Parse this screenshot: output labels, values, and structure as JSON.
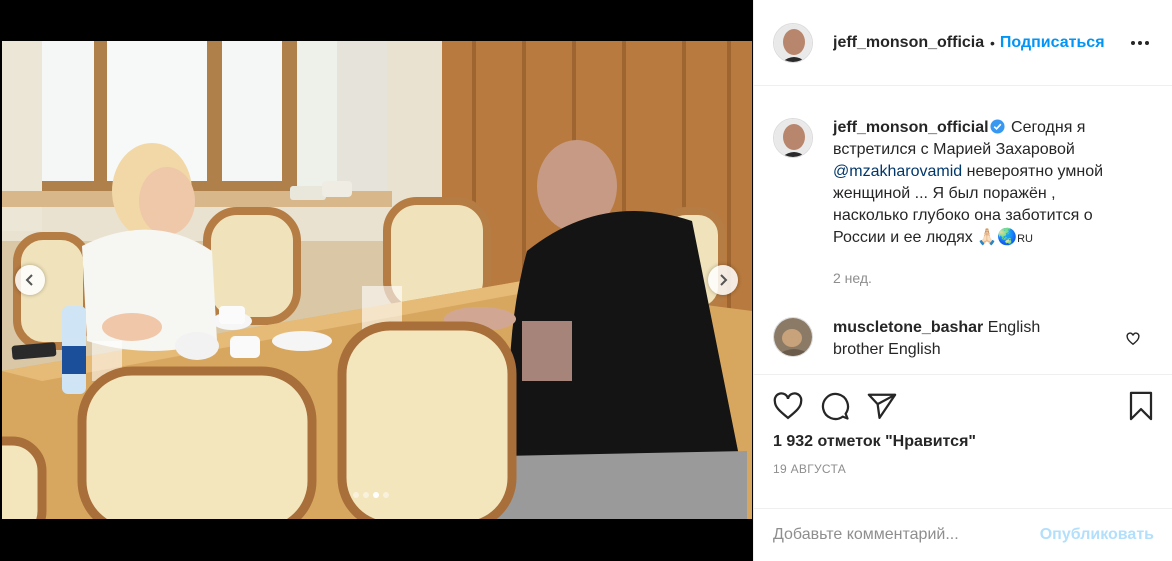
{
  "post": {
    "username": "jeff_monson_official",
    "separator": "•",
    "follow_label": "Подписаться",
    "more_icon": "more-dots-icon",
    "verified_icon": "verified-badge-icon",
    "caption_before_mention": "Сегодня я встретился с Марией Захаровой ",
    "mention": "@mzakharovamid",
    "caption_after_mention": " невероятно умной женщиной ... Я был поражён , насколько глубоко она заботится о России и ее людях ",
    "caption_emoji": "🙏🏻🌏",
    "caption_tail": "RU",
    "caption_time": "2 нед.",
    "likes": "1 932 отметок \"Нравится\"",
    "date": "19 АВГУСТА"
  },
  "comments": [
    {
      "username": "muscletone_bashar",
      "text": "English brother English"
    }
  ],
  "media": {
    "slides": 4,
    "active_slide": 3,
    "prev_icon": "chevron-left-icon",
    "next_icon": "chevron-right-icon"
  },
  "comment_box": {
    "placeholder": "Добавьте комментарий...",
    "publish_label": "Опубликовать"
  },
  "colors": {
    "accent": "#0095f6",
    "publish_disabled": "#b2dffc",
    "muted": "#8e8e8e",
    "verified": "#3897f0"
  }
}
